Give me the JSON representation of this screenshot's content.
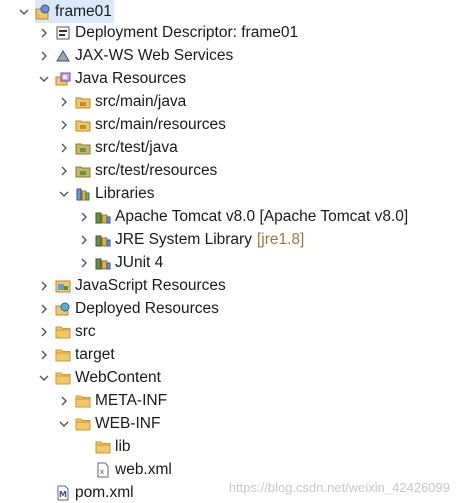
{
  "tree": {
    "rows": [
      {
        "label": "frame01",
        "icon": "web-project-icon",
        "expanded": true,
        "selected": true
      },
      {
        "label": "Deployment Descriptor: frame01",
        "icon": "deployment-descriptor-icon",
        "expanded": false
      },
      {
        "label": "JAX-WS Web Services",
        "icon": "web-services-icon",
        "expanded": false
      },
      {
        "label": "Java Resources",
        "icon": "java-resources-icon",
        "expanded": true
      },
      {
        "label": "src/main/java",
        "icon": "source-folder-icon",
        "expanded": false
      },
      {
        "label": "src/main/resources",
        "icon": "source-folder-icon",
        "expanded": false
      },
      {
        "label": "src/test/java",
        "icon": "test-source-folder-icon",
        "expanded": false
      },
      {
        "label": "src/test/resources",
        "icon": "test-source-folder-icon",
        "expanded": false
      },
      {
        "label": "Libraries",
        "icon": "libraries-icon",
        "expanded": true
      },
      {
        "label": "Apache Tomcat v8.0 [Apache Tomcat v8.0]",
        "icon": "library-icon",
        "expanded": false
      },
      {
        "label": "JRE System Library",
        "decoration": "[jre1.8]",
        "icon": "library-icon",
        "expanded": false
      },
      {
        "label": "JUnit 4",
        "icon": "library-icon",
        "expanded": false
      },
      {
        "label": "JavaScript Resources",
        "icon": "javascript-resources-icon",
        "expanded": false
      },
      {
        "label": "Deployed Resources",
        "icon": "deployed-resources-icon",
        "expanded": false
      },
      {
        "label": "src",
        "icon": "folder-icon",
        "expanded": false
      },
      {
        "label": "target",
        "icon": "folder-icon",
        "expanded": false
      },
      {
        "label": "WebContent",
        "icon": "folder-icon",
        "expanded": true
      },
      {
        "label": "META-INF",
        "icon": "folder-icon",
        "expanded": false
      },
      {
        "label": "WEB-INF",
        "icon": "folder-icon",
        "expanded": true
      },
      {
        "label": "lib",
        "icon": "folder-icon",
        "expanded": false,
        "leaf": true
      },
      {
        "label": "web.xml",
        "icon": "xml-file-icon",
        "leaf": true
      },
      {
        "label": "pom.xml",
        "icon": "maven-pom-icon",
        "leaf": true
      }
    ]
  },
  "watermark": "https://blog.csdn.net/weixin_42426099",
  "colors": {
    "selection": "#d9e8fb",
    "folder": "#e8b34a",
    "chevron": "#555555",
    "decoration": "#9a7a3a"
  }
}
